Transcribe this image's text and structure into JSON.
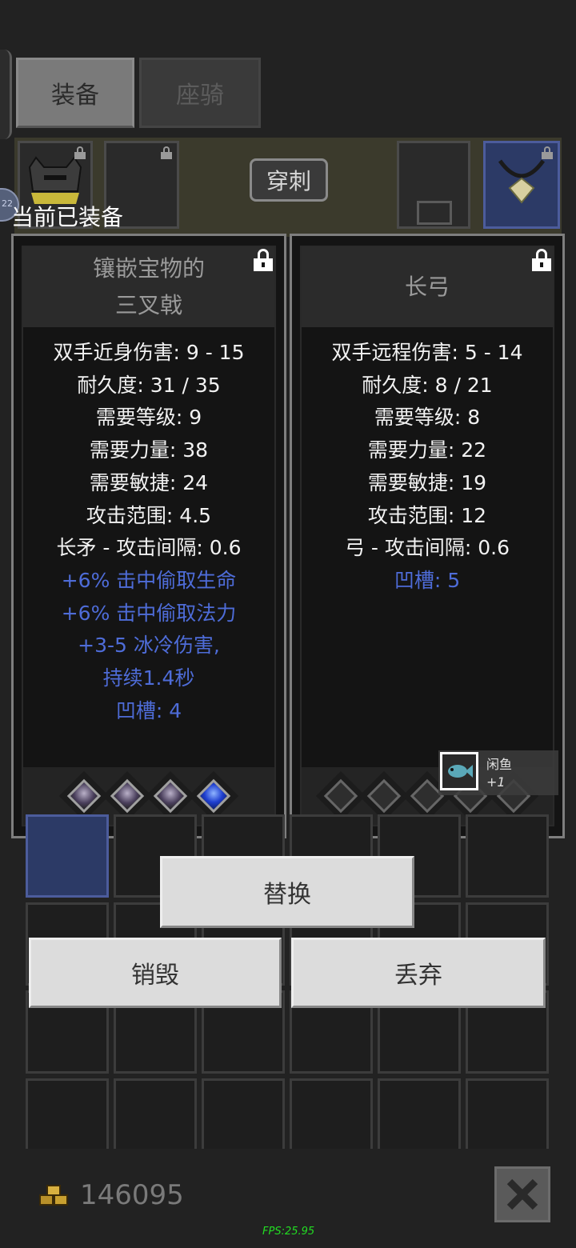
{
  "tabs": [
    {
      "label": "装备",
      "active": true
    },
    {
      "label": "座骑",
      "active": false
    }
  ],
  "background": {
    "pierce_label": "穿刺",
    "damage_badge_text": "22"
  },
  "equipped_label": "当前已装备",
  "left_panel": {
    "title_line1": "镶嵌宝物的",
    "title_line2": "三叉戟",
    "stats": [
      {
        "text": "双手近身伤害: 9 - 15",
        "color": "white"
      },
      {
        "text": "耐久度: 31 / 35",
        "color": "white"
      },
      {
        "text": "需要等级: 9",
        "color": "white"
      },
      {
        "text": "需要力量: 38",
        "color": "white"
      },
      {
        "text": "需要敏捷: 24",
        "color": "white"
      },
      {
        "text": "攻击范围: 4.5",
        "color": "white"
      },
      {
        "text": "长矛 - 攻击间隔: 0.6",
        "color": "white"
      },
      {
        "text": "+6% 击中偷取生命",
        "color": "blue"
      },
      {
        "text": "+6% 击中偷取法力",
        "color": "blue"
      },
      {
        "text": "+3-5 冰冷伤害,",
        "color": "blue"
      },
      {
        "text": "持续1.4秒",
        "color": "blue"
      },
      {
        "text": "凹槽: 4",
        "color": "blue"
      }
    ],
    "sockets": [
      "dark-gem",
      "dark-gem",
      "dark-gem",
      "blue-gem"
    ]
  },
  "right_panel": {
    "title": "长弓",
    "stats": [
      {
        "text": "双手远程伤害: 5 - 14",
        "color": "white"
      },
      {
        "text": "耐久度: 8 / 21",
        "color": "white"
      },
      {
        "text": "需要等级: 8",
        "color": "white"
      },
      {
        "text": "需要力量: 22",
        "color": "white"
      },
      {
        "text": "需要敏捷: 19",
        "color": "white"
      },
      {
        "text": "攻击范围: 12",
        "color": "white"
      },
      {
        "text": "弓 - 攻击间隔: 0.6",
        "color": "white"
      },
      {
        "text": "凹槽: 5",
        "color": "blue"
      }
    ],
    "sockets": [
      "empty",
      "empty",
      "empty",
      "empty",
      "empty"
    ]
  },
  "popup": {
    "name": "闲鱼",
    "plus": "+1",
    "icon": "fish-icon"
  },
  "buttons": {
    "replace": "替换",
    "destroy": "销毁",
    "drop": "丢弃"
  },
  "footer": {
    "gold": "146095",
    "fps": "FPS:25.95"
  },
  "colors": {
    "stat_blue": "#4e6cd8",
    "stat_white": "#f2f2f2",
    "fps_green": "#22dd22"
  }
}
